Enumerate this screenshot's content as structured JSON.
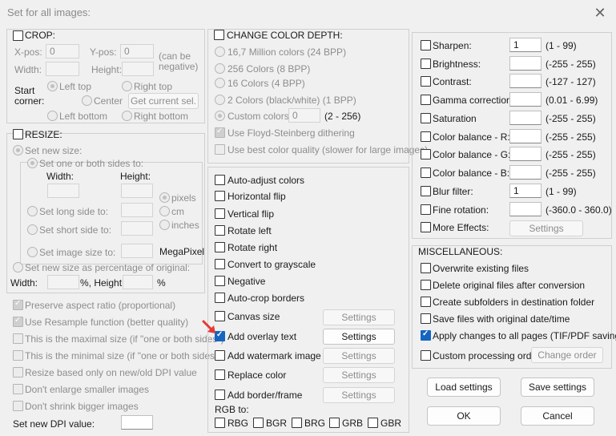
{
  "window": {
    "title": "Set for all images:",
    "close_glyph": "✕"
  },
  "crop": {
    "title": "CROP:",
    "xpos_label": "X-pos:",
    "xpos_value": "0",
    "ypos_label": "Y-pos:",
    "ypos_value": "0",
    "neg_note_1": "(can be",
    "neg_note_2": "negative)",
    "width_label": "Width:",
    "height_label": "Height:",
    "start_1": "Start",
    "start_2": "corner:",
    "left_top": "Left top",
    "right_top": "Right top",
    "center": "Center",
    "left_bottom": "Left bottom",
    "right_bottom": "Right bottom",
    "get_current": "Get current sel."
  },
  "resize": {
    "title": "RESIZE:",
    "set_new_size": "Set new size:",
    "one_or_both": "Set one or both sides to:",
    "width": "Width:",
    "height": "Height:",
    "pixels": "pixels",
    "cm": "cm",
    "inches": "inches",
    "long_side": "Set long side to:",
    "short_side": "Set short side to:",
    "image_size": "Set image size to:",
    "megapixel": "MegaPixel",
    "percentage": "Set new size as percentage of original:",
    "pct_width": "Width:",
    "pct_sep": "%, Height:",
    "pct_end": "%",
    "preserve": "Preserve aspect ratio (proportional)",
    "resample": "Use Resample function (better quality)",
    "maximal": "This is the maximal size (if \"one or both sides\")",
    "minimal": "This is the minimal size (if \"one or both sides\")",
    "dpi_based": "Resize based only on new/old DPI value",
    "dont_enlarge": "Don't enlarge smaller images",
    "dont_shrink": "Don't shrink bigger images",
    "dpi_label": "Set new DPI value:"
  },
  "color_depth": {
    "title": "CHANGE COLOR DEPTH:",
    "opt24": "16,7 Million colors (24 BPP)",
    "opt8": "256 Colors (8 BPP)",
    "opt4": "16 Colors (4 BPP)",
    "opt1": "2 Colors (black/white) (1 BPP)",
    "custom": "Custom colors:",
    "custom_value": "0",
    "custom_range": "(2 - 256)",
    "floyd": "Use Floyd-Steinberg dithering",
    "best": "Use best color quality (slower for large images)"
  },
  "transforms": {
    "auto_adjust": "Auto-adjust colors",
    "hflip": "Horizontal flip",
    "vflip": "Vertical flip",
    "rot_left": "Rotate left",
    "rot_right": "Rotate right",
    "grayscale": "Convert to grayscale",
    "negative": "Negative",
    "autocrop": "Auto-crop borders",
    "canvas": "Canvas size",
    "overlay": "Add overlay text",
    "watermark": "Add watermark image",
    "replace": "Replace color",
    "border": "Add border/frame",
    "settings": "Settings",
    "rgb_to": "RGB to:",
    "rbg": "RBG",
    "bgr": "BGR",
    "brg": "BRG",
    "grb": "GRB",
    "gbr": "GBR"
  },
  "adjust": {
    "sharpen": "Sharpen:",
    "sharpen_value": "1",
    "sharpen_range": "(1 - 99)",
    "brightness": "Brightness:",
    "brightness_range": "(-255 - 255)",
    "contrast": "Contrast:",
    "contrast_range": "(-127 - 127)",
    "gamma": "Gamma correction:",
    "gamma_range": "(0.01 - 6.99)",
    "saturation": "Saturation",
    "saturation_range": "(-255 - 255)",
    "cb_r": "Color balance - R:",
    "cb_r_range": "(-255 - 255)",
    "cb_g": "Color balance - G:",
    "cb_g_range": "(-255 - 255)",
    "cb_b": "Color balance - B:",
    "cb_b_range": "(-255 - 255)",
    "blur": "Blur filter:",
    "blur_value": "1",
    "blur_range": "(1 - 99)",
    "fine_rot": "Fine rotation:",
    "fine_rot_range": "(-360.0 - 360.0)",
    "more": "More Effects:",
    "settings": "Settings"
  },
  "misc": {
    "title": "MISCELLANEOUS:",
    "overwrite": "Overwrite existing files",
    "delete_orig": "Delete original files after conversion",
    "subfolders": "Create subfolders in destination folder",
    "save_date": "Save files with original date/time",
    "apply_all": "Apply changes to all pages (TIF/PDF saving)",
    "custom_order": "Custom processing order",
    "change_order": "Change order"
  },
  "footer": {
    "load": "Load settings",
    "save": "Save settings",
    "ok": "OK",
    "cancel": "Cancel"
  },
  "colors": {
    "accent": "#1565c0",
    "arrow": "#e53935"
  }
}
